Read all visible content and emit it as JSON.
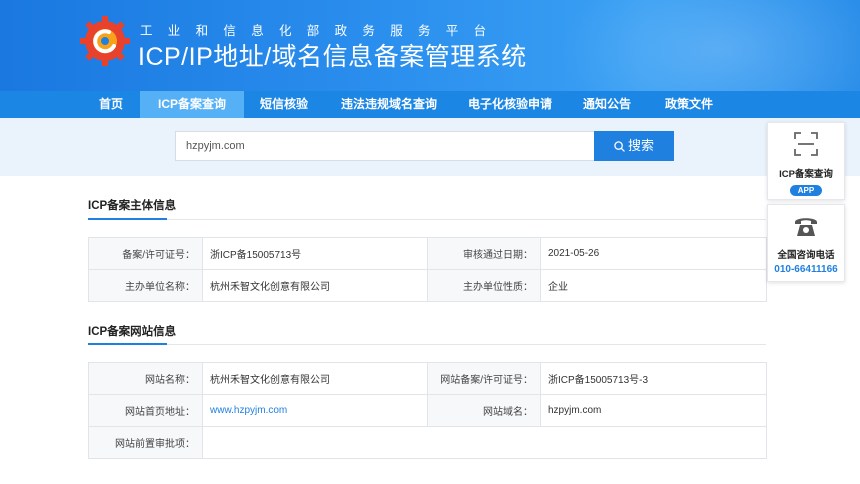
{
  "header": {
    "subtitle": "工业和信息化部政务服务平台",
    "title": "ICP/IP地址/域名信息备案管理系统",
    "brand_color": "#1a78e0"
  },
  "nav": {
    "items": [
      {
        "label": "首页"
      },
      {
        "label": "ICP备案查询"
      },
      {
        "label": "短信核验"
      },
      {
        "label": "违法违规域名查询"
      },
      {
        "label": "电子化核验申请"
      },
      {
        "label": "通知公告"
      },
      {
        "label": "政策文件"
      }
    ],
    "active_index": 1
  },
  "search": {
    "value": "hzpyjm.com",
    "button_label": "搜索",
    "button_icon": "search-icon"
  },
  "subject_section": {
    "title": "ICP备案主体信息",
    "rows": [
      {
        "label1": "备案/许可证号：",
        "value1": "浙ICP备15005713号",
        "label2": "审核通过日期：",
        "value2": "2021-05-26"
      },
      {
        "label1": "主办单位名称：",
        "value1": "杭州禾智文化创意有限公司",
        "label2": "主办单位性质：",
        "value2": "企业"
      }
    ]
  },
  "website_section": {
    "title": "ICP备案网站信息",
    "rows": [
      {
        "label1": "网站名称：",
        "value1": "杭州禾智文化创意有限公司",
        "label2": "网站备案/许可证号：",
        "value2": "浙ICP备15005713号-3"
      },
      {
        "label1": "网站首页地址：",
        "value1": "www.hzpyjm.com",
        "label2": "网站域名：",
        "value2": "hzpyjm.com"
      },
      {
        "label1": "网站前置审批项：",
        "value1": ""
      }
    ]
  },
  "sidebar": {
    "app_card": {
      "label": "ICP备案查询",
      "badge": "APP",
      "icon": "scan-icon"
    },
    "phone_card": {
      "label": "全国咨询电话",
      "number": "010-66411166",
      "icon": "telephone-icon"
    }
  }
}
